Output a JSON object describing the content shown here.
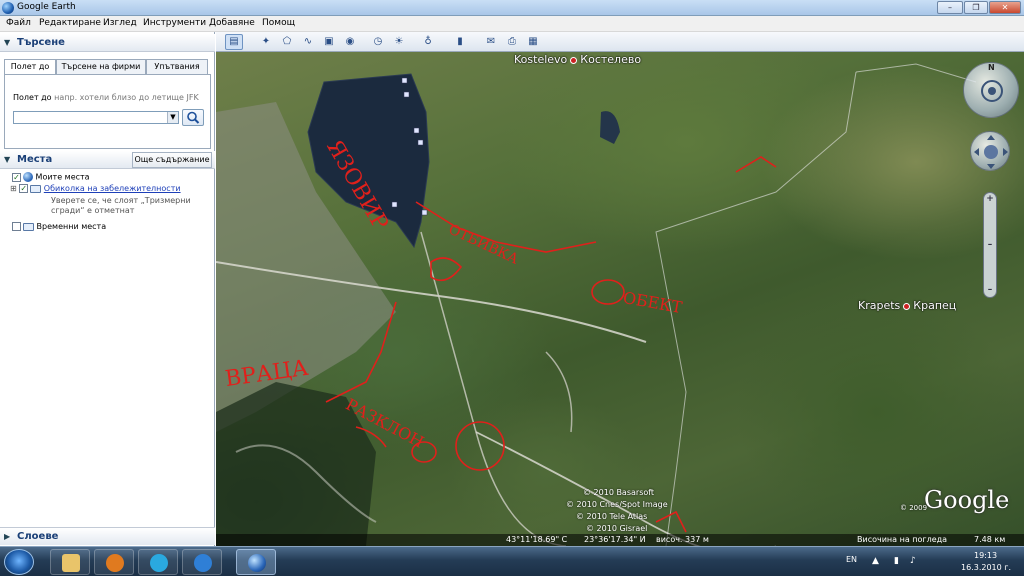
{
  "window": {
    "title": "Google Earth",
    "btn_min": "–",
    "btn_max": "❐",
    "btn_close": "✕"
  },
  "menu": [
    "Файл",
    "Редактиране",
    "Изглед",
    "Инструменти",
    "Добавяне",
    "Помощ"
  ],
  "search": {
    "header": "Търсене",
    "tabs": [
      "Полет до",
      "Търсене на фирми",
      "Упътвания"
    ],
    "hint_label": "Полет до",
    "hint_placeholder": "напр. хотели близо до летище JFK",
    "input_value": ""
  },
  "places": {
    "header": "Места",
    "add_content": "Още съдържание",
    "items": [
      {
        "label": "Моите места"
      },
      {
        "label": "Обиколка на забележителности",
        "note": "Уверете се, че слоят „Тризмерни сгради“ е отметнат"
      },
      {
        "label": "Временни места"
      }
    ]
  },
  "layers": {
    "header": "Слоеве"
  },
  "map": {
    "labels": [
      {
        "text_left": "Kostelevo",
        "text_right": "Костелево"
      },
      {
        "text_left": "Krapets",
        "text_right": "Крапец"
      }
    ],
    "credits": [
      "© 2010 Basarsoft",
      "© 2010 Cnes/Spot Image",
      "© 2010 Tele Atlas",
      "© 2010 Gisrael"
    ],
    "year_mark": "© 2009",
    "logo": "Google",
    "status": {
      "lat": "43°11'18.69\" С",
      "lon": "23°36'17.34\" И",
      "elev": "височ.   337 м",
      "eye_alt_label": "Височина на погледа",
      "eye_alt_value": "7.48 км"
    },
    "handwriting": [
      "ЯЗОВИР",
      "ВРАЦА",
      "РАЗКЛОН",
      "ОТБИВКА",
      "ОБЕКТ"
    ]
  },
  "taskbar": {
    "lang": "EN",
    "time": "19:13",
    "date": "16.3.2010 г."
  }
}
